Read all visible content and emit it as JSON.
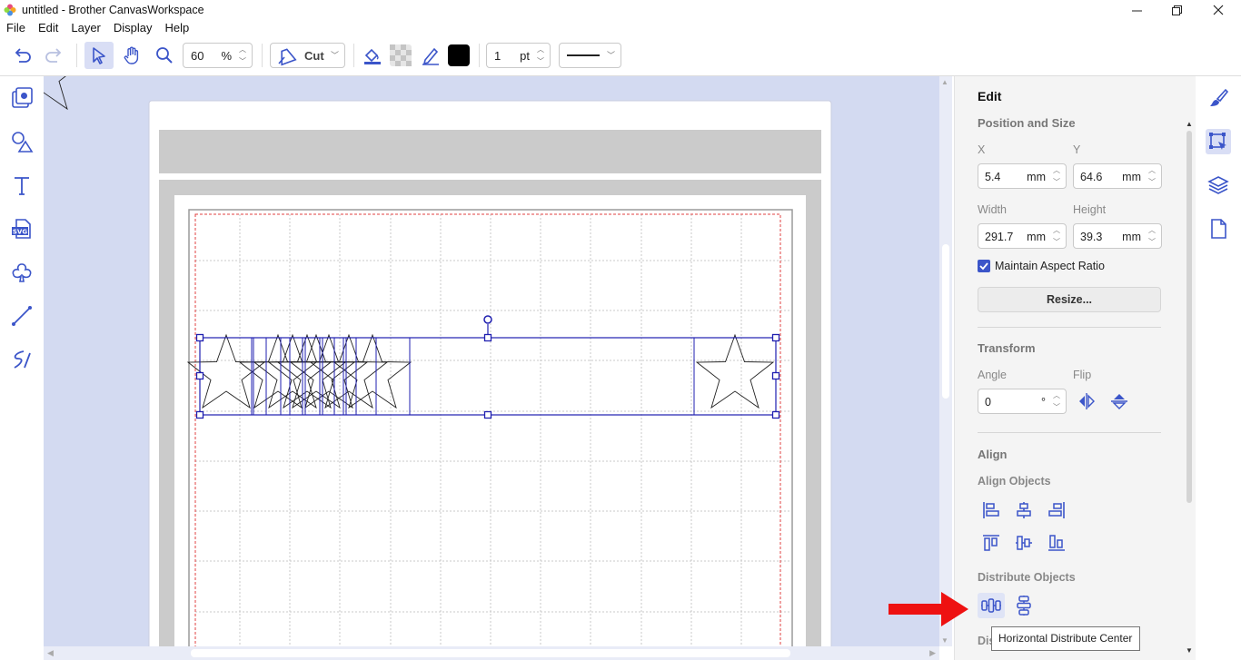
{
  "window": {
    "title": "untitled - Brother CanvasWorkspace"
  },
  "menu": [
    "File",
    "Edit",
    "Layer",
    "Display",
    "Help"
  ],
  "toolbar": {
    "zoom_value": "60",
    "zoom_unit": "%",
    "mode_label": "Cut",
    "stroke_width_value": "1",
    "stroke_width_unit": "pt",
    "line_color": "#000000"
  },
  "left_tools": [
    "object-panel-icon",
    "shapes-icon",
    "text-icon",
    "svg-import-icon",
    "blob-shape-icon",
    "line-icon",
    "freehand-icon"
  ],
  "right_tabs": [
    "brush-icon",
    "edit-panel-icon",
    "layers-icon",
    "page-icon"
  ],
  "edit_panel": {
    "title": "Edit",
    "position_size": {
      "heading": "Position and Size",
      "x_label": "X",
      "x_value": "5.4",
      "y_label": "Y",
      "y_value": "64.6",
      "width_label": "Width",
      "width_value": "291.7",
      "height_label": "Height",
      "height_value": "39.3",
      "unit": "mm",
      "maintain_aspect_label": "Maintain Aspect Ratio",
      "maintain_aspect_checked": true,
      "resize_label": "Resize..."
    },
    "transform": {
      "heading": "Transform",
      "angle_label": "Angle",
      "angle_value": "0",
      "angle_unit": "°",
      "flip_label": "Flip"
    },
    "align": {
      "heading": "Align",
      "align_objects_label": "Align Objects",
      "distribute_objects_label": "Distribute Objects",
      "truncated_label": "Dis"
    }
  },
  "tooltip": "Horizontal Distribute Center",
  "accent_color": "#3b55c9",
  "selection_color": "#1f1fb0"
}
